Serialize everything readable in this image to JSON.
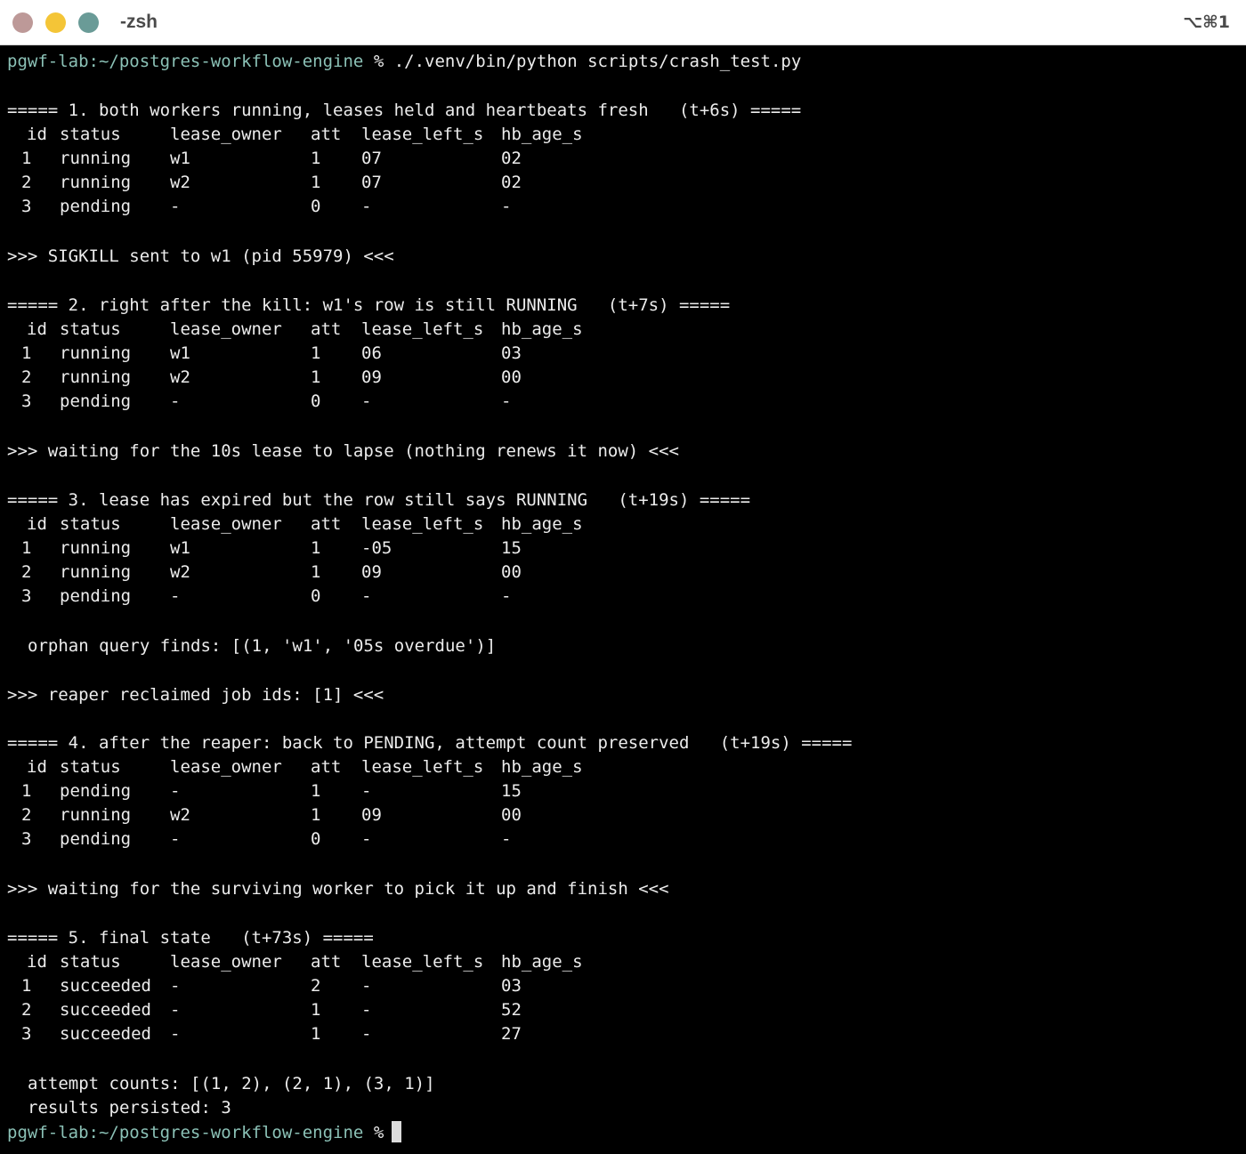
{
  "window": {
    "title": "-zsh",
    "shortcut": "⌥⌘1"
  },
  "prompt": {
    "host": "pgwf-lab",
    "path": ":~/postgres-workflow-engine",
    "symbol": "%",
    "command": "./.venv/bin/python scripts/crash_test.py"
  },
  "table_header": {
    "id": "id",
    "status": "status",
    "lease_owner": "lease_owner",
    "att": "att",
    "lease_left_s": "lease_left_s",
    "hb_age_s": "hb_age_s"
  },
  "sections": [
    {
      "heading": "===== 1. both workers running, leases held and heartbeats fresh   (t+6s) =====",
      "rows": [
        [
          "1",
          "running",
          "w1",
          "1",
          "07",
          "02"
        ],
        [
          "2",
          "running",
          "w2",
          "1",
          "07",
          "02"
        ],
        [
          "3",
          "pending",
          "-",
          "0",
          "-",
          "-"
        ]
      ]
    },
    {
      "heading": "===== 2. right after the kill: w1's row is still RUNNING   (t+7s) =====",
      "rows": [
        [
          "1",
          "running",
          "w1",
          "1",
          "06",
          "03"
        ],
        [
          "2",
          "running",
          "w2",
          "1",
          "09",
          "00"
        ],
        [
          "3",
          "pending",
          "-",
          "0",
          "-",
          "-"
        ]
      ]
    },
    {
      "heading": "===== 3. lease has expired but the row still says RUNNING   (t+19s) =====",
      "rows": [
        [
          "1",
          "running",
          "w1",
          "1",
          "-05",
          "15"
        ],
        [
          "2",
          "running",
          "w2",
          "1",
          "09",
          "00"
        ],
        [
          "3",
          "pending",
          "-",
          "0",
          "-",
          "-"
        ]
      ]
    },
    {
      "heading": "===== 4. after the reaper: back to PENDING, attempt count preserved   (t+19s) =====",
      "rows": [
        [
          "1",
          "pending",
          "-",
          "1",
          "-",
          "15"
        ],
        [
          "2",
          "running",
          "w2",
          "1",
          "09",
          "00"
        ],
        [
          "3",
          "pending",
          "-",
          "0",
          "-",
          "-"
        ]
      ]
    },
    {
      "heading": "===== 5. final state   (t+73s) =====",
      "rows": [
        [
          "1",
          "succeeded",
          "-",
          "2",
          "-",
          "03"
        ],
        [
          "2",
          "succeeded",
          "-",
          "1",
          "-",
          "52"
        ],
        [
          "3",
          "succeeded",
          "-",
          "1",
          "-",
          "27"
        ]
      ]
    }
  ],
  "messages": {
    "sigkill": ">>> SIGKILL sent to w1 (pid 55979) <<<",
    "waiting_lease": ">>> waiting for the 10s lease to lapse (nothing renews it now) <<<",
    "orphan": "orphan query finds: [(1, 'w1', '05s overdue')]",
    "reaper": ">>> reaper reclaimed job ids: [1] <<<",
    "waiting_worker": ">>> waiting for the surviving worker to pick it up and finish <<<",
    "attempt_counts": "attempt counts: [(1, 2), (2, 1), (3, 1)]",
    "results_persisted": "results persisted: 3"
  }
}
